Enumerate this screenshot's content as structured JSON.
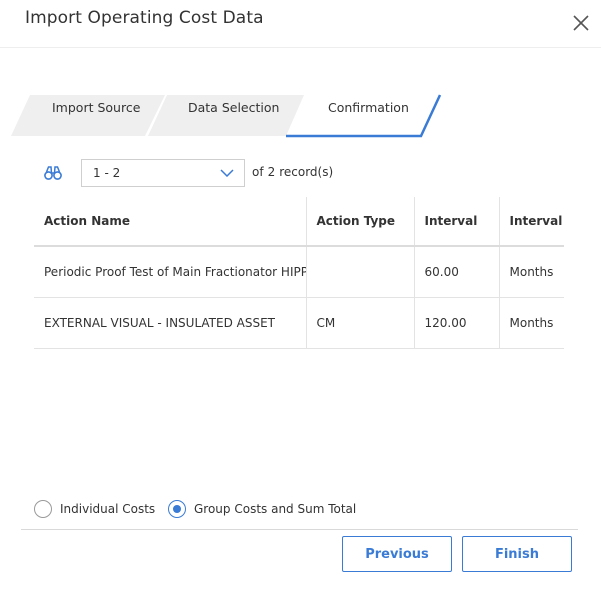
{
  "dialog": {
    "title": "Import Operating Cost Data"
  },
  "wizard": {
    "steps": [
      {
        "label": "Import Source"
      },
      {
        "label": "Data Selection"
      },
      {
        "label": "Confirmation"
      }
    ],
    "active_step": "Confirmation"
  },
  "toolbar": {
    "search_icon": "binoculars-icon",
    "pager_value": "1 - 2",
    "of_label": "of",
    "record_count": "2",
    "records_label": "record(s)"
  },
  "grid": {
    "columns": [
      "Action Name",
      "Action Type",
      "Interval",
      "Interval Units"
    ],
    "rows": [
      [
        "Periodic Proof Test of Main Fractionator HIPPS",
        "",
        "60.00",
        "Months"
      ],
      [
        "EXTERNAL VISUAL - INSULATED ASSET",
        "CM",
        "120.00",
        "Months"
      ]
    ]
  },
  "options": {
    "individual_label": "Individual Costs",
    "group_label": "Group Costs and Sum Total",
    "selected": "group"
  },
  "buttons": {
    "previous": "Previous",
    "finish": "Finish"
  },
  "colors": {
    "accent": "#3a7bd5",
    "tab_bg": "#efefef"
  }
}
